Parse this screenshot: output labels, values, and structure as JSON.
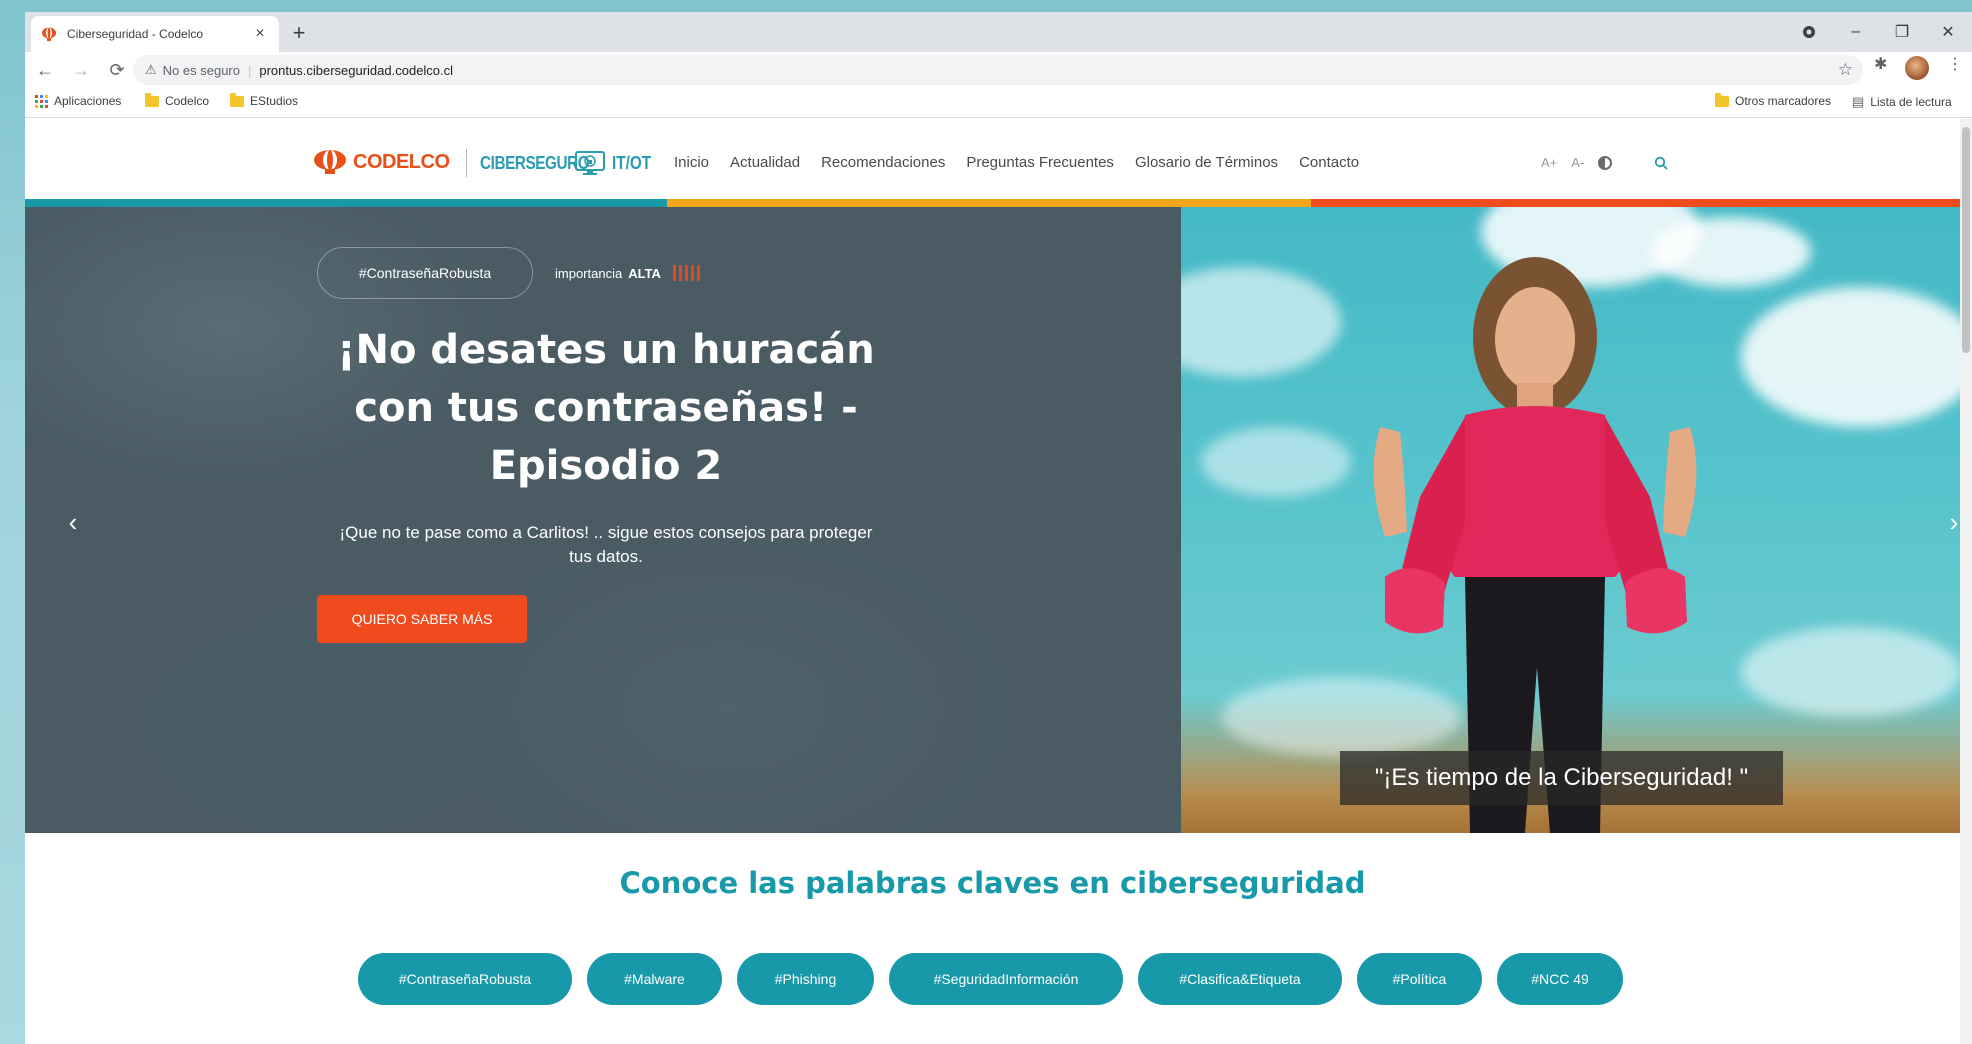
{
  "browser": {
    "tab_title": "Ciberseguridad - Codelco",
    "tab_close": "×",
    "new_tab": "+",
    "url": "prontus.ciberseguridad.codelco.cl",
    "security_label": "No es seguro",
    "window_controls": {
      "minimize": "–",
      "restore": "❐",
      "close": "✕"
    }
  },
  "bookmarks": {
    "apps": "Aplicaciones",
    "items": [
      "Codelco",
      "EStudios"
    ],
    "other": "Otros marcadores",
    "reading_list": "Lista de lectura"
  },
  "site": {
    "logo_codelco": "CODELCO",
    "logo_ciber": "CIBERSEGURO",
    "logo_itot": "IT/OT",
    "nav": [
      "Inicio",
      "Actualidad",
      "Recomendaciones",
      "Preguntas Frecuentes",
      "Glosario de Términos",
      "Contacto"
    ],
    "font_increase": "A+",
    "font_decrease": "A-",
    "colors": {
      "teal": "#1899a9",
      "orange": "#f04b1d",
      "yellow": "#f3a51c"
    }
  },
  "hero": {
    "tag": "#ContraseñaRobusta",
    "importance_label": "importancia",
    "importance_value": "ALTA",
    "title": "¡No desates un huracán con tus contraseñas! - Episodio 2",
    "subtitle": "¡Que no te pase como a Carlitos! .. sigue estos consejos para proteger tus datos.",
    "cta": "QUIERO SABER MÁS",
    "caption": "\"¡Es tiempo de la Ciberseguridad! \"",
    "prev": "‹",
    "next": "›"
  },
  "keywords": {
    "title": "Conoce las palabras claves en ciberseguridad",
    "tags": [
      "#ContraseñaRobusta",
      "#Malware",
      "#Phishing",
      "#SeguridadInformación",
      "#Clasifica&Etiqueta",
      "#Política",
      "#NCC 49"
    ]
  }
}
